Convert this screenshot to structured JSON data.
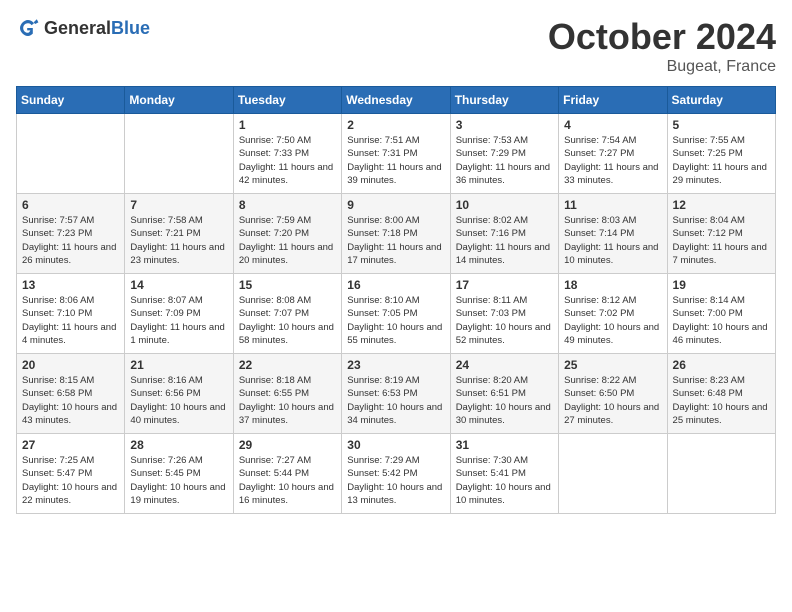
{
  "header": {
    "logo_general": "General",
    "logo_blue": "Blue",
    "month": "October 2024",
    "location": "Bugeat, France"
  },
  "weekdays": [
    "Sunday",
    "Monday",
    "Tuesday",
    "Wednesday",
    "Thursday",
    "Friday",
    "Saturday"
  ],
  "weeks": [
    [
      {
        "day": "",
        "sunrise": "",
        "sunset": "",
        "daylight": ""
      },
      {
        "day": "",
        "sunrise": "",
        "sunset": "",
        "daylight": ""
      },
      {
        "day": "1",
        "sunrise": "Sunrise: 7:50 AM",
        "sunset": "Sunset: 7:33 PM",
        "daylight": "Daylight: 11 hours and 42 minutes."
      },
      {
        "day": "2",
        "sunrise": "Sunrise: 7:51 AM",
        "sunset": "Sunset: 7:31 PM",
        "daylight": "Daylight: 11 hours and 39 minutes."
      },
      {
        "day": "3",
        "sunrise": "Sunrise: 7:53 AM",
        "sunset": "Sunset: 7:29 PM",
        "daylight": "Daylight: 11 hours and 36 minutes."
      },
      {
        "day": "4",
        "sunrise": "Sunrise: 7:54 AM",
        "sunset": "Sunset: 7:27 PM",
        "daylight": "Daylight: 11 hours and 33 minutes."
      },
      {
        "day": "5",
        "sunrise": "Sunrise: 7:55 AM",
        "sunset": "Sunset: 7:25 PM",
        "daylight": "Daylight: 11 hours and 29 minutes."
      }
    ],
    [
      {
        "day": "6",
        "sunrise": "Sunrise: 7:57 AM",
        "sunset": "Sunset: 7:23 PM",
        "daylight": "Daylight: 11 hours and 26 minutes."
      },
      {
        "day": "7",
        "sunrise": "Sunrise: 7:58 AM",
        "sunset": "Sunset: 7:21 PM",
        "daylight": "Daylight: 11 hours and 23 minutes."
      },
      {
        "day": "8",
        "sunrise": "Sunrise: 7:59 AM",
        "sunset": "Sunset: 7:20 PM",
        "daylight": "Daylight: 11 hours and 20 minutes."
      },
      {
        "day": "9",
        "sunrise": "Sunrise: 8:00 AM",
        "sunset": "Sunset: 7:18 PM",
        "daylight": "Daylight: 11 hours and 17 minutes."
      },
      {
        "day": "10",
        "sunrise": "Sunrise: 8:02 AM",
        "sunset": "Sunset: 7:16 PM",
        "daylight": "Daylight: 11 hours and 14 minutes."
      },
      {
        "day": "11",
        "sunrise": "Sunrise: 8:03 AM",
        "sunset": "Sunset: 7:14 PM",
        "daylight": "Daylight: 11 hours and 10 minutes."
      },
      {
        "day": "12",
        "sunrise": "Sunrise: 8:04 AM",
        "sunset": "Sunset: 7:12 PM",
        "daylight": "Daylight: 11 hours and 7 minutes."
      }
    ],
    [
      {
        "day": "13",
        "sunrise": "Sunrise: 8:06 AM",
        "sunset": "Sunset: 7:10 PM",
        "daylight": "Daylight: 11 hours and 4 minutes."
      },
      {
        "day": "14",
        "sunrise": "Sunrise: 8:07 AM",
        "sunset": "Sunset: 7:09 PM",
        "daylight": "Daylight: 11 hours and 1 minute."
      },
      {
        "day": "15",
        "sunrise": "Sunrise: 8:08 AM",
        "sunset": "Sunset: 7:07 PM",
        "daylight": "Daylight: 10 hours and 58 minutes."
      },
      {
        "day": "16",
        "sunrise": "Sunrise: 8:10 AM",
        "sunset": "Sunset: 7:05 PM",
        "daylight": "Daylight: 10 hours and 55 minutes."
      },
      {
        "day": "17",
        "sunrise": "Sunrise: 8:11 AM",
        "sunset": "Sunset: 7:03 PM",
        "daylight": "Daylight: 10 hours and 52 minutes."
      },
      {
        "day": "18",
        "sunrise": "Sunrise: 8:12 AM",
        "sunset": "Sunset: 7:02 PM",
        "daylight": "Daylight: 10 hours and 49 minutes."
      },
      {
        "day": "19",
        "sunrise": "Sunrise: 8:14 AM",
        "sunset": "Sunset: 7:00 PM",
        "daylight": "Daylight: 10 hours and 46 minutes."
      }
    ],
    [
      {
        "day": "20",
        "sunrise": "Sunrise: 8:15 AM",
        "sunset": "Sunset: 6:58 PM",
        "daylight": "Daylight: 10 hours and 43 minutes."
      },
      {
        "day": "21",
        "sunrise": "Sunrise: 8:16 AM",
        "sunset": "Sunset: 6:56 PM",
        "daylight": "Daylight: 10 hours and 40 minutes."
      },
      {
        "day": "22",
        "sunrise": "Sunrise: 8:18 AM",
        "sunset": "Sunset: 6:55 PM",
        "daylight": "Daylight: 10 hours and 37 minutes."
      },
      {
        "day": "23",
        "sunrise": "Sunrise: 8:19 AM",
        "sunset": "Sunset: 6:53 PM",
        "daylight": "Daylight: 10 hours and 34 minutes."
      },
      {
        "day": "24",
        "sunrise": "Sunrise: 8:20 AM",
        "sunset": "Sunset: 6:51 PM",
        "daylight": "Daylight: 10 hours and 30 minutes."
      },
      {
        "day": "25",
        "sunrise": "Sunrise: 8:22 AM",
        "sunset": "Sunset: 6:50 PM",
        "daylight": "Daylight: 10 hours and 27 minutes."
      },
      {
        "day": "26",
        "sunrise": "Sunrise: 8:23 AM",
        "sunset": "Sunset: 6:48 PM",
        "daylight": "Daylight: 10 hours and 25 minutes."
      }
    ],
    [
      {
        "day": "27",
        "sunrise": "Sunrise: 7:25 AM",
        "sunset": "Sunset: 5:47 PM",
        "daylight": "Daylight: 10 hours and 22 minutes."
      },
      {
        "day": "28",
        "sunrise": "Sunrise: 7:26 AM",
        "sunset": "Sunset: 5:45 PM",
        "daylight": "Daylight: 10 hours and 19 minutes."
      },
      {
        "day": "29",
        "sunrise": "Sunrise: 7:27 AM",
        "sunset": "Sunset: 5:44 PM",
        "daylight": "Daylight: 10 hours and 16 minutes."
      },
      {
        "day": "30",
        "sunrise": "Sunrise: 7:29 AM",
        "sunset": "Sunset: 5:42 PM",
        "daylight": "Daylight: 10 hours and 13 minutes."
      },
      {
        "day": "31",
        "sunrise": "Sunrise: 7:30 AM",
        "sunset": "Sunset: 5:41 PM",
        "daylight": "Daylight: 10 hours and 10 minutes."
      },
      {
        "day": "",
        "sunrise": "",
        "sunset": "",
        "daylight": ""
      },
      {
        "day": "",
        "sunrise": "",
        "sunset": "",
        "daylight": ""
      }
    ]
  ]
}
